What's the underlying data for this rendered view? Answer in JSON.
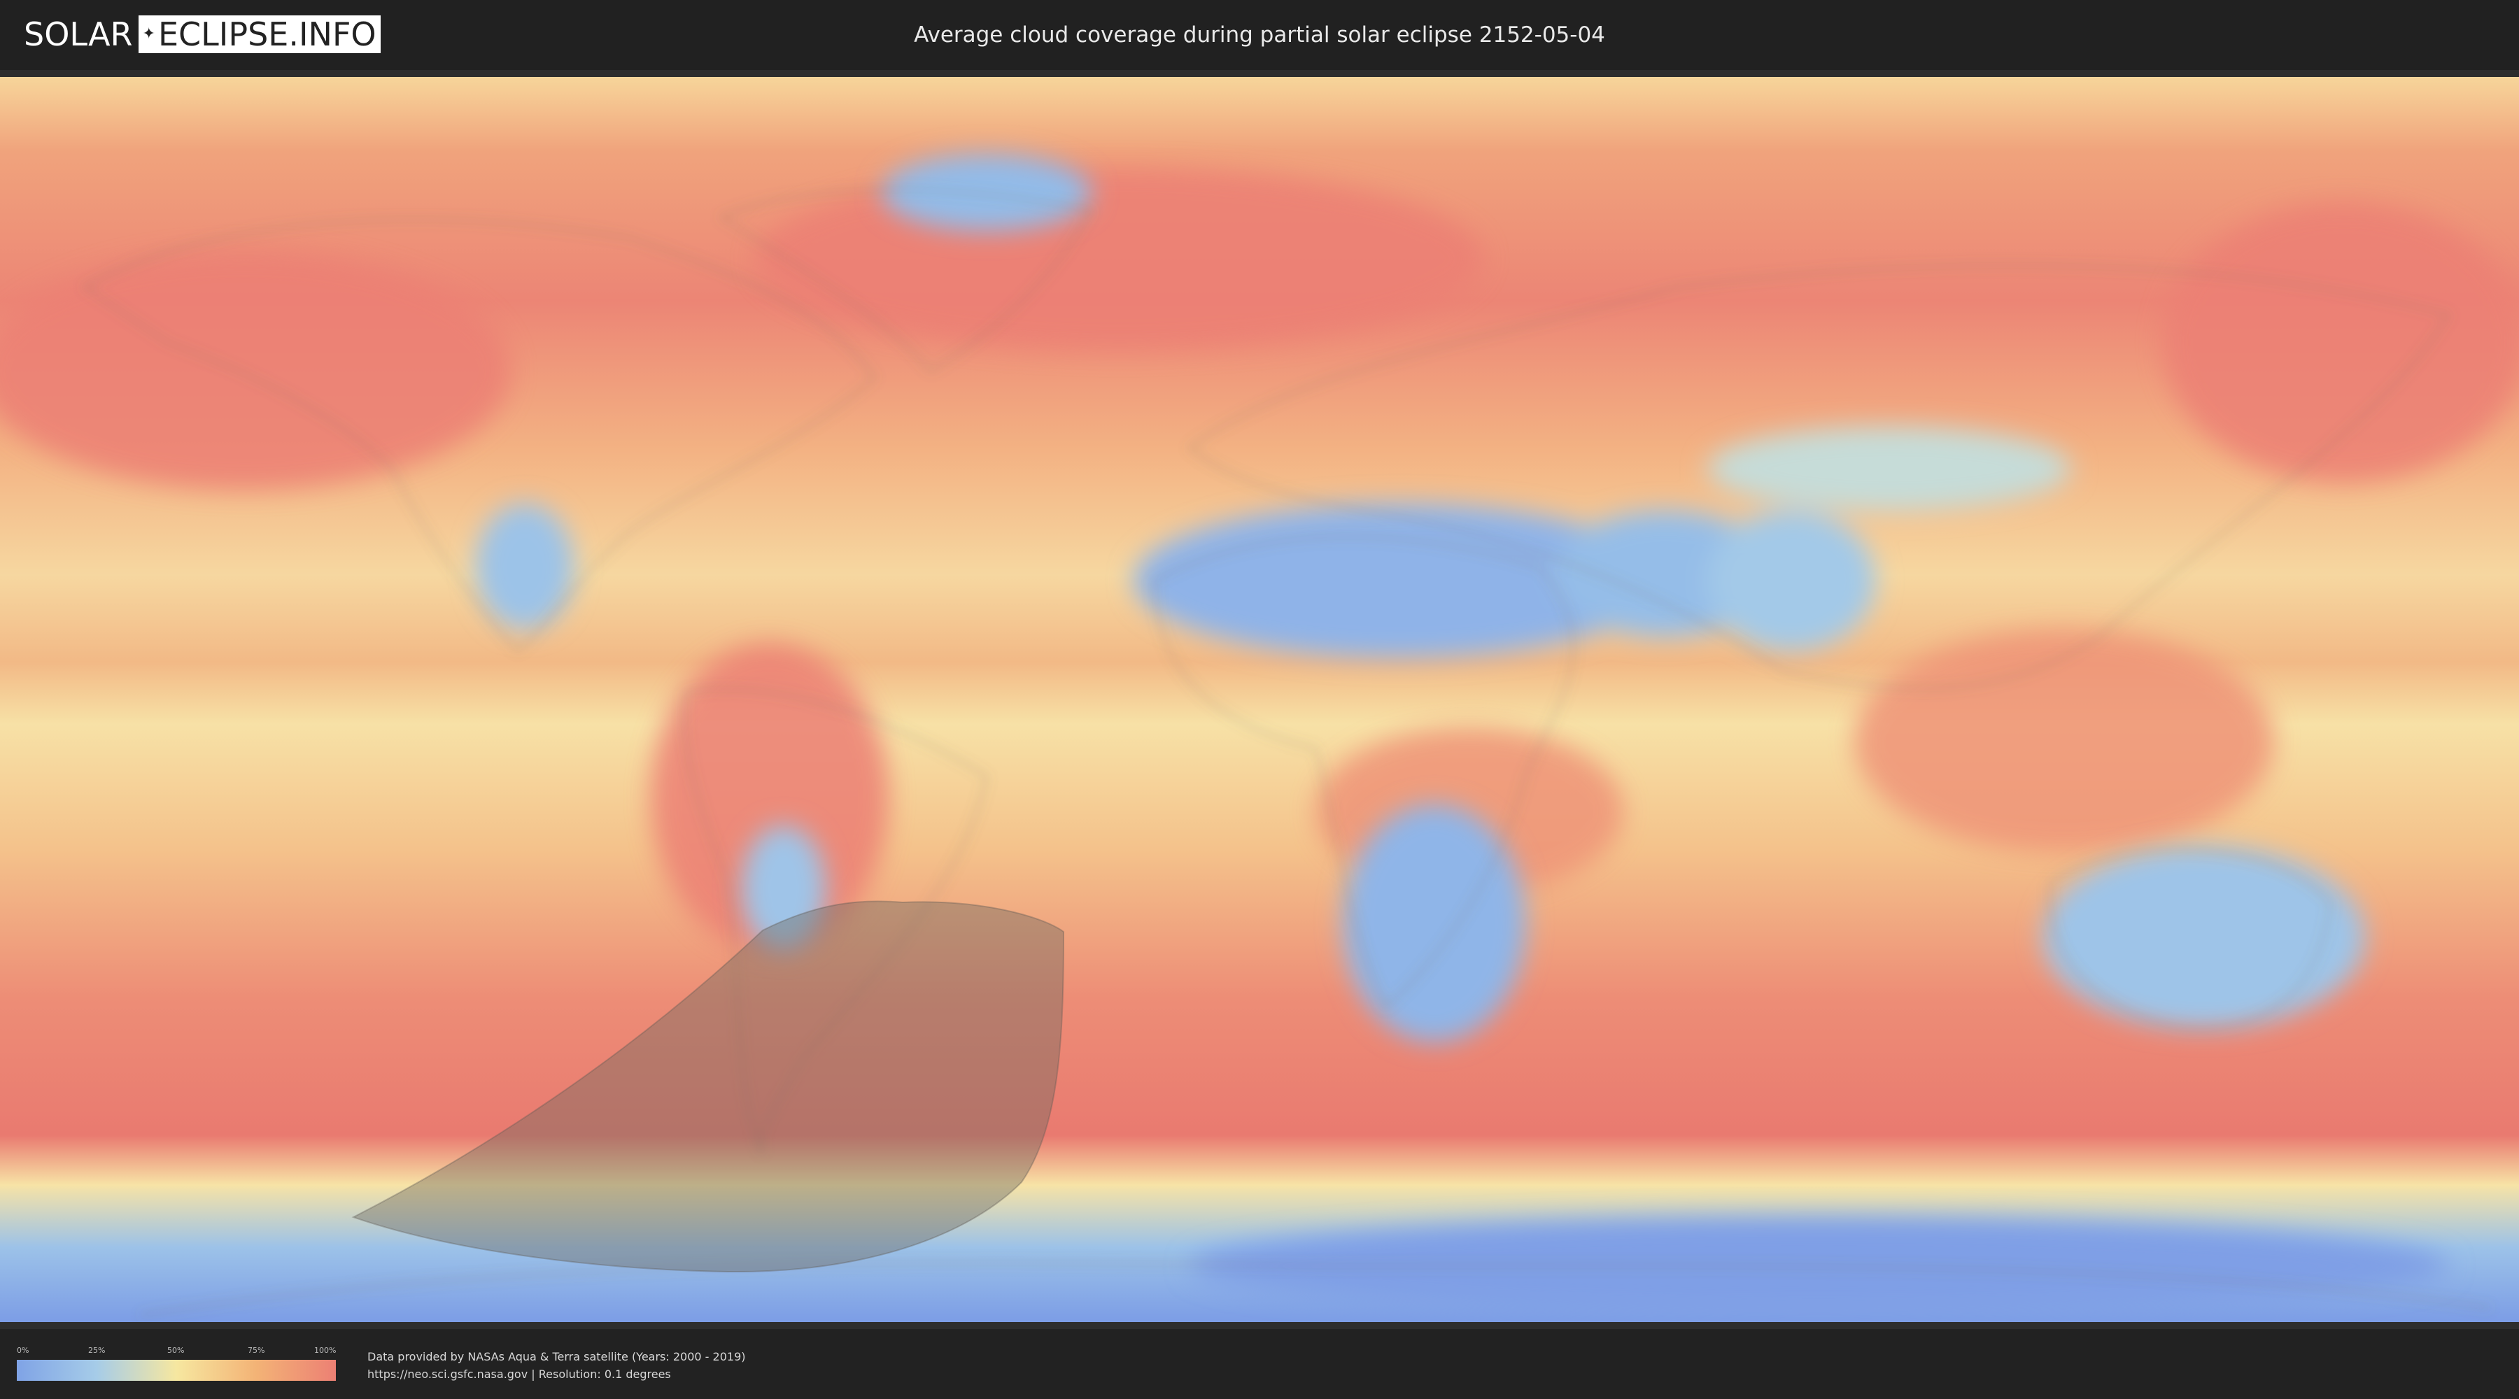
{
  "header": {
    "logo_left": "SOLAR",
    "logo_right": "ECLIPSE.INFO",
    "title": "Average cloud coverage during partial solar eclipse 2152-05-04"
  },
  "legend": {
    "ticks": [
      "0%",
      "25%",
      "50%",
      "75%",
      "100%"
    ],
    "colors": [
      "#7fa3e6",
      "#a6cce8",
      "#f6e7a0",
      "#f3b376",
      "#ec8074"
    ]
  },
  "credits": {
    "line1": "Data provided by NASAs Aqua & Terra satellite (Years: 2000 - 2019)",
    "line2": "https://neo.sci.gsfc.nasa.gov | Resolution: 0.1 degrees"
  },
  "map": {
    "projection": "equirectangular",
    "eclipse_zone": "partial eclipse visibility region over southern South America and South Atlantic",
    "colors": {
      "ocean_cloudy": "#ec8074",
      "mid": "#f4bd84",
      "light": "#f6e2a2",
      "clear": "#8eb7e8"
    }
  }
}
